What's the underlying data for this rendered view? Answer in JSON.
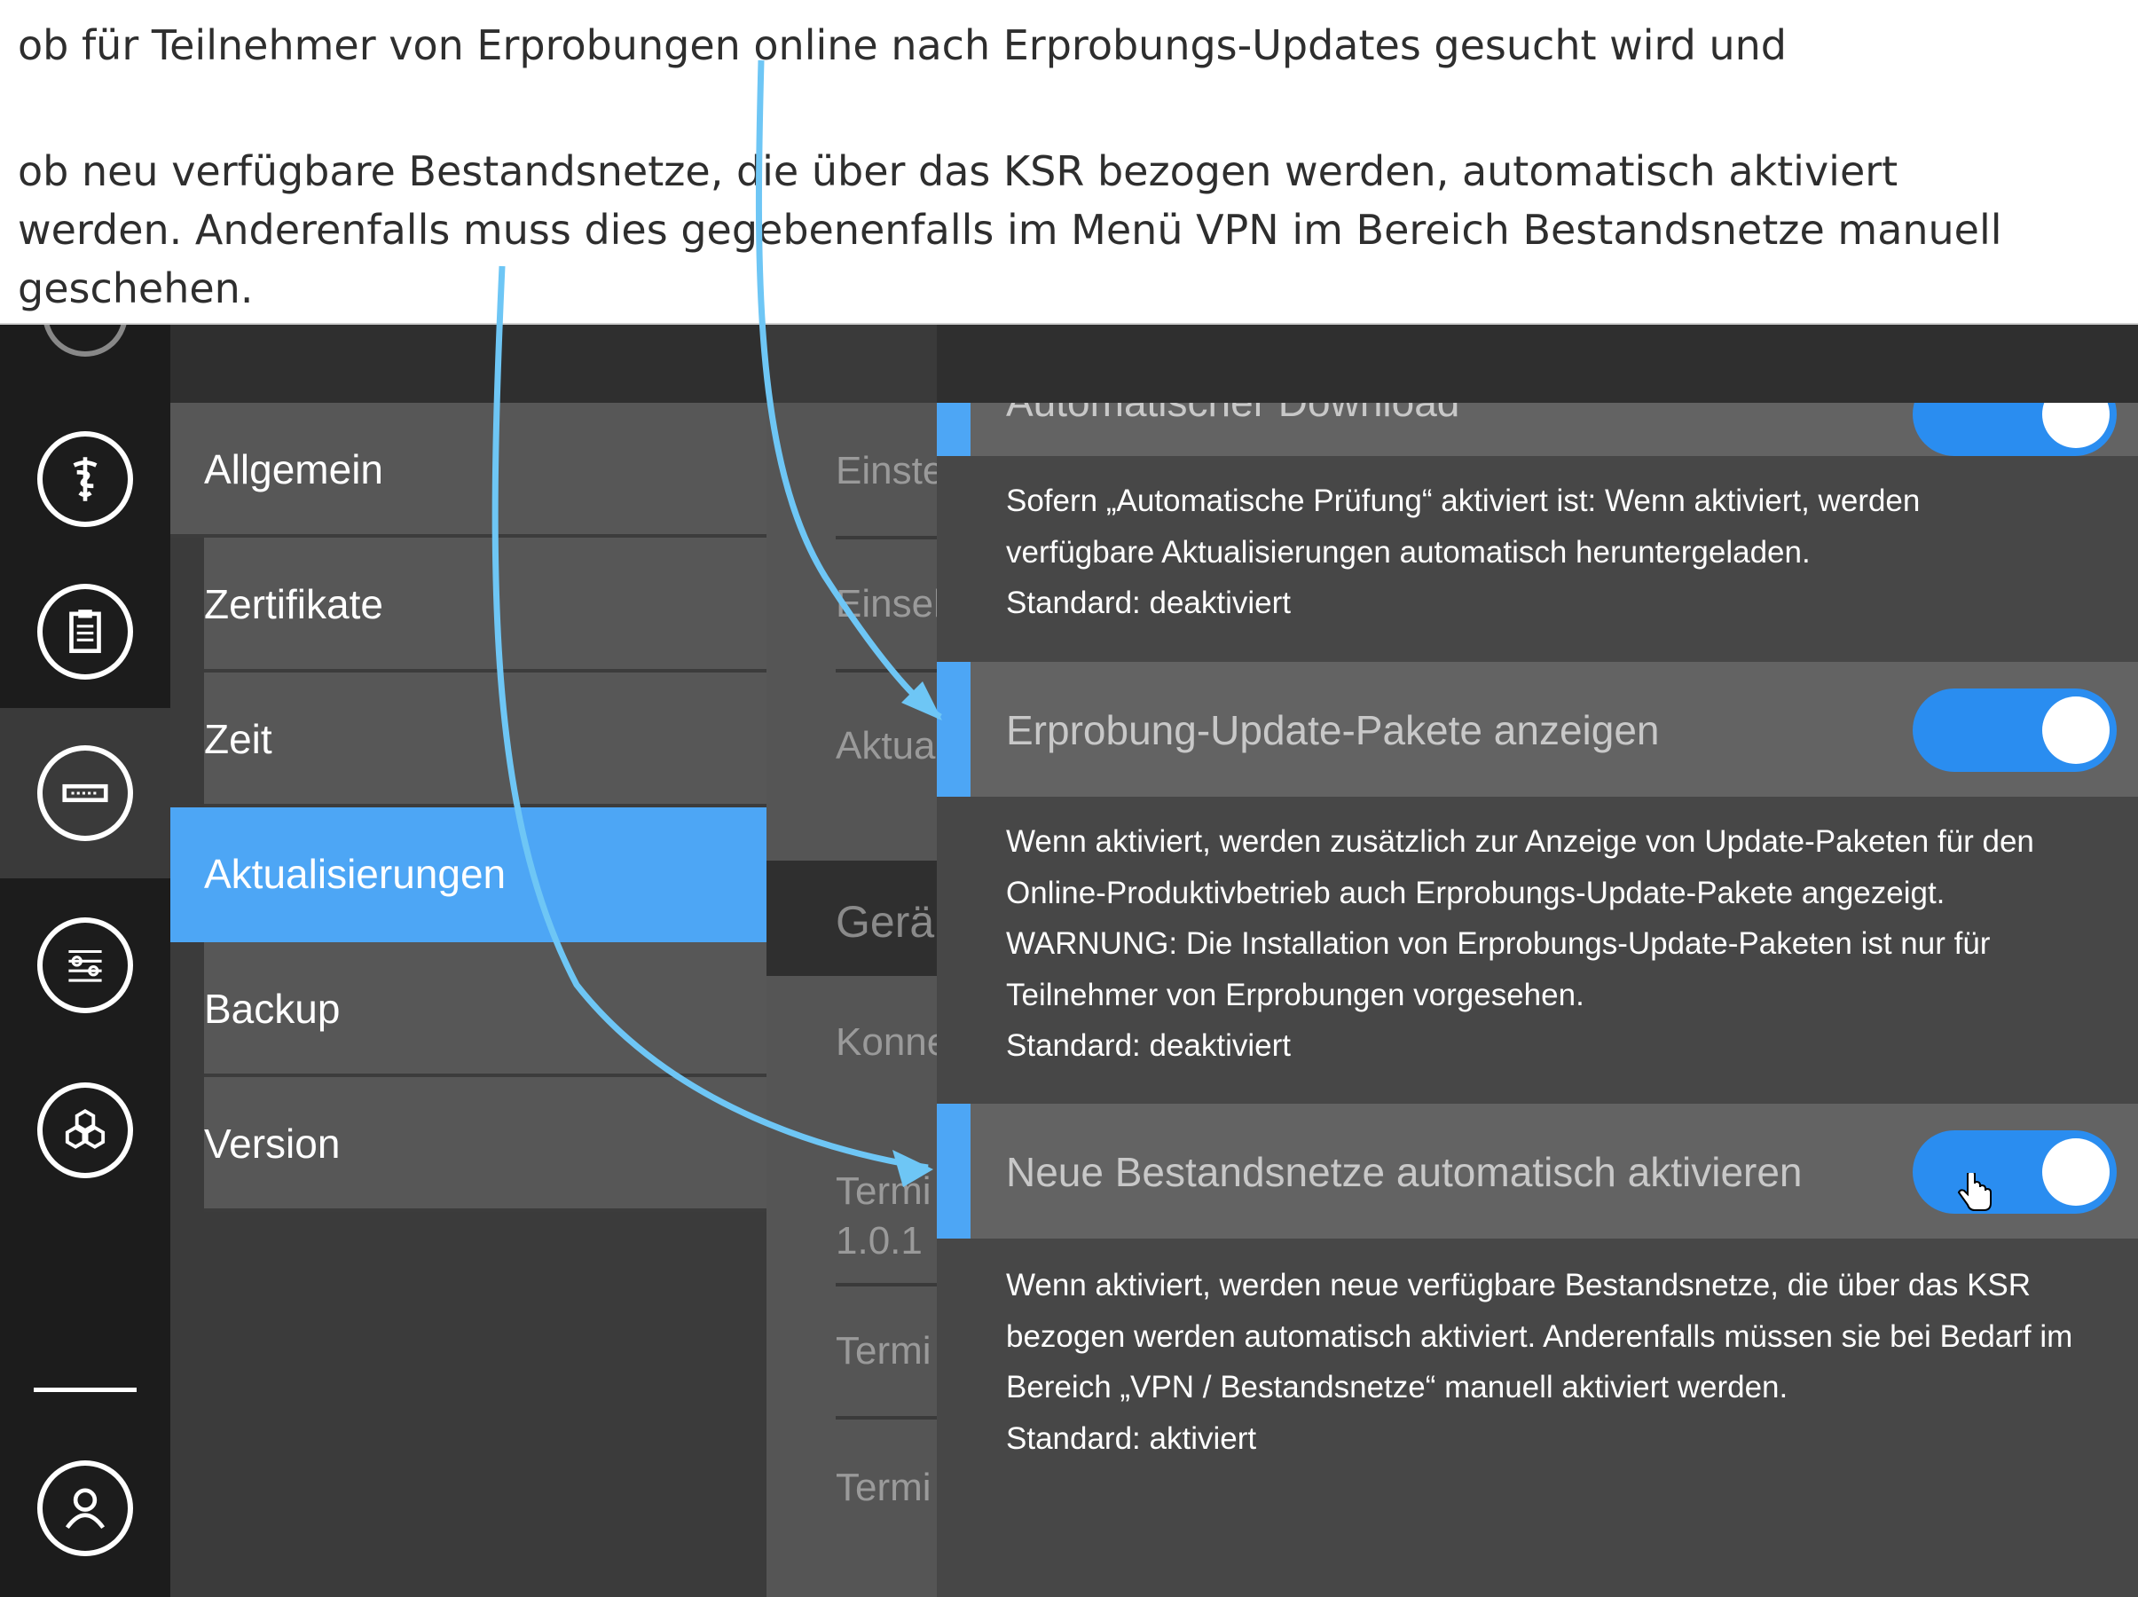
{
  "doc": {
    "line1": "ob für Teilnehmer von Erprobungen online nach Erprobungs-Updates gesucht wird und",
    "line2": "ob neu verfügbare Bestandsnetze, die über das KSR bezogen werden, automatisch aktiviert",
    "line3": "werden. Anderenfalls muss dies gegebenenfalls im Menü VPN im Bereich Bestandsnetze manuell",
    "line4": "geschehen."
  },
  "rail": {
    "items": [
      {
        "icon": "caduceus-icon"
      },
      {
        "icon": "clipboard-icon"
      },
      {
        "icon": "router-icon",
        "active": true
      },
      {
        "icon": "sliders-icon"
      },
      {
        "icon": "hexagons-icon"
      },
      {
        "icon": "user-icon"
      }
    ]
  },
  "menu": {
    "items": [
      {
        "label": "Allgemein"
      },
      {
        "label": "Zertifikate"
      },
      {
        "label": "Zeit"
      },
      {
        "label": "Aktualisierungen",
        "selected": true
      },
      {
        "label": "Backup"
      },
      {
        "label": "Version"
      }
    ]
  },
  "middle": {
    "rows": [
      "Einste",
      "Einsel",
      "Aktua",
      "Gerä",
      "Konne",
      "Termi",
      "1.0.1 .",
      "Termi",
      "Termi"
    ]
  },
  "settings": {
    "partial_title": "Automatischer Download",
    "desc_auto_download": {
      "line1": "Sofern „Automatische Prüfung“ aktiviert ist: Wenn aktiviert, werden",
      "line2": "verfügbare Aktualisierungen automatisch heruntergeladen.",
      "line3": "Standard: deaktiviert"
    },
    "trial_updates": {
      "title": "Erprobung-Update-Pakete anzeigen",
      "enabled": true,
      "line1": "Wenn aktiviert, werden zusätzlich zur Anzeige von Update-Paketen für den",
      "line2": "Online-Produktivbetrieb auch Erprobungs-Update-Pakete angezeigt.",
      "line3": "WARNUNG: Die Installation von Erprobungs-Update-Paketen ist nur für",
      "line4": "Teilnehmer von Erprobungen vorgesehen.",
      "line5": "Standard: deaktiviert"
    },
    "new_networks": {
      "title": "Neue Bestandsnetze automatisch aktivieren",
      "enabled": true,
      "line1": "Wenn aktiviert, werden neue verfügbare Bestandsnetze, die über das KSR",
      "line2": "bezogen werden automatisch aktiviert. Anderenfalls müssen sie bei Bedarf im",
      "line3": "Bereich „VPN / Bestandsnetze“ manuell aktiviert werden.",
      "line4": "Standard: aktiviert"
    }
  },
  "colors": {
    "accent": "#4da6f5",
    "toggle": "#2a8df0",
    "arrow": "#6ec6f5"
  }
}
